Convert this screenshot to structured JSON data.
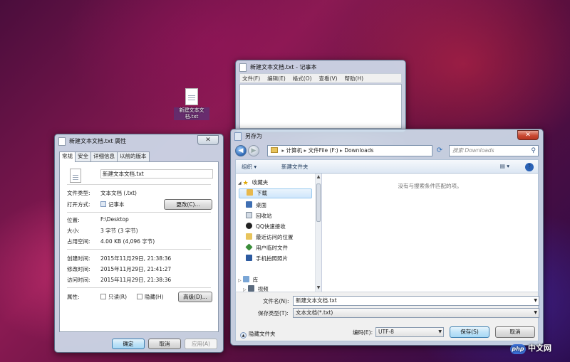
{
  "desktop": {
    "icon_label": "新建文本文档.txt"
  },
  "notepad": {
    "title": "新建文本文档.txt - 记事本",
    "menu": [
      "文件(F)",
      "编辑(E)",
      "格式(O)",
      "查看(V)",
      "帮助(H)"
    ]
  },
  "properties": {
    "title": "新建文本文档.txt 属性",
    "tabs": [
      "常规",
      "安全",
      "详细信息",
      "以前的版本"
    ],
    "filename": "新建文本文档.txt",
    "type_label": "文件类型:",
    "type_value": "文本文档 (.txt)",
    "open_label": "打开方式:",
    "open_value": "记事本",
    "change_button": "更改(C)...",
    "location_label": "位置:",
    "location_value": "F:\\Desktop",
    "size_label": "大小:",
    "size_value": "3 字节 (3 字节)",
    "disk_label": "占用空间:",
    "disk_value": "4.00 KB (4,096 字节)",
    "created_label": "创建时间:",
    "created_value": "2015年11月29日, 21:38:36",
    "modified_label": "修改时间:",
    "modified_value": "2015年11月29日, 21:41:27",
    "accessed_label": "访问时间:",
    "accessed_value": "2015年11月29日, 21:38:36",
    "attr_label": "属性:",
    "readonly_label": "只读(R)",
    "hidden_label": "隐藏(H)",
    "advanced_button": "高级(D)...",
    "ok_button": "确定",
    "cancel_button": "取消",
    "apply_button": "应用(A)"
  },
  "saveas": {
    "title": "另存为",
    "address": [
      "计算机",
      "文件File (F:)",
      "Downloads"
    ],
    "search_placeholder": "搜索 Downloads",
    "organize": "组织 ▾",
    "new_folder": "新建文件夹",
    "nav_items": [
      "收藏夹",
      "下载",
      "桌面",
      "回收站",
      "QQ快速接收",
      "最近访问的位置",
      "用户临时文件",
      "手机拍照照片",
      "库",
      "视频"
    ],
    "empty_text": "没有与搜索条件匹配的项。",
    "filename_label": "文件名(N):",
    "filename_value": "新建文本文档.txt",
    "filetype_label": "保存类型(T):",
    "filetype_value": "文本文档(*.txt)",
    "hide_folders": "隐藏文件夹",
    "encoding_label": "编码(E):",
    "encoding_value": "UTF-8",
    "save_button": "保存(S)",
    "cancel_button": "取消"
  },
  "watermark": {
    "logo": "php",
    "text": "中文网"
  }
}
